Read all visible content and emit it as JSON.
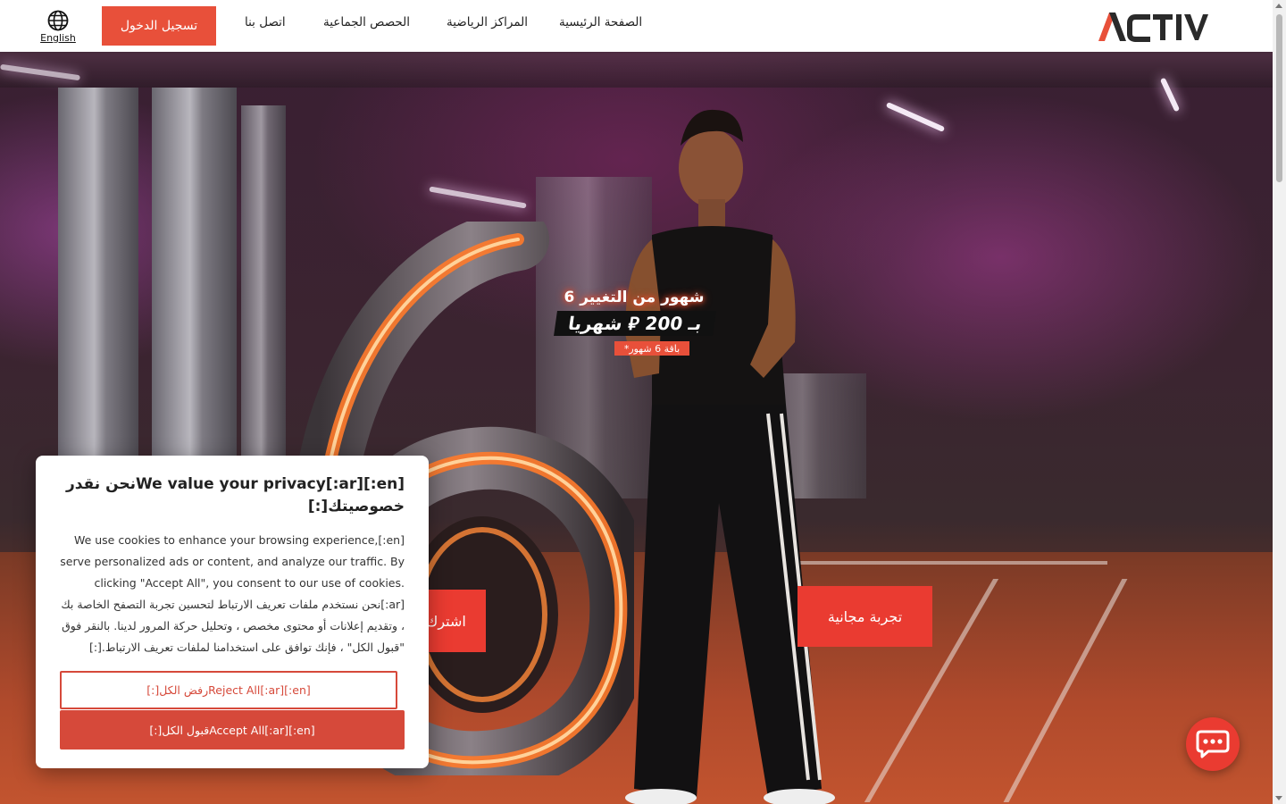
{
  "header": {
    "language_label": "English",
    "login_label": "تسجيل الدخول",
    "nav": {
      "contact": "اتصل بنا",
      "group_classes": "الحصص الجماعية",
      "sports_centers": "المراكز الرياضية",
      "home": "الصفحة الرئيسية"
    },
    "logo_text": "ACTIV"
  },
  "hero": {
    "promo_title": "6 شهور من التغيير",
    "promo_price": "بـ 200 ⃁ شهريا",
    "promo_note": "*باقة 6 شهور",
    "trial_button": "تجربة مجانية",
    "subscribe_button": "اشترك"
  },
  "cookie": {
    "title": "[en:]We value your privacy[:ar]نحن نقدر خصوصيتك[:]",
    "body": "[en:]We use cookies to enhance your browsing experience, serve personalized ads or content, and analyze our traffic. By clicking \"Accept All\", you consent to our use of cookies.[:ar]نحن نستخدم ملفات تعريف الارتباط لتحسين تجربة التصفح الخاصة بك ، وتقديم إعلانات أو محتوى مخصص ، وتحليل حركة المرور لدينا. بالنقر فوق \"قبول الكل\" ، فإنك توافق على استخدامنا لملفات تعريف الارتباط.[:]",
    "reject_label": "[en:]Reject All[:ar]رفض الكل[:]",
    "accept_label": "[en:]Accept All[:ar]قبول الكل[:]"
  },
  "colors": {
    "brand_red": "#e8503a",
    "button_red": "#ea3b31",
    "cookie_red": "#d6493a"
  },
  "icons": {
    "language": "globe-icon",
    "chat": "chat-bubble-icon"
  }
}
